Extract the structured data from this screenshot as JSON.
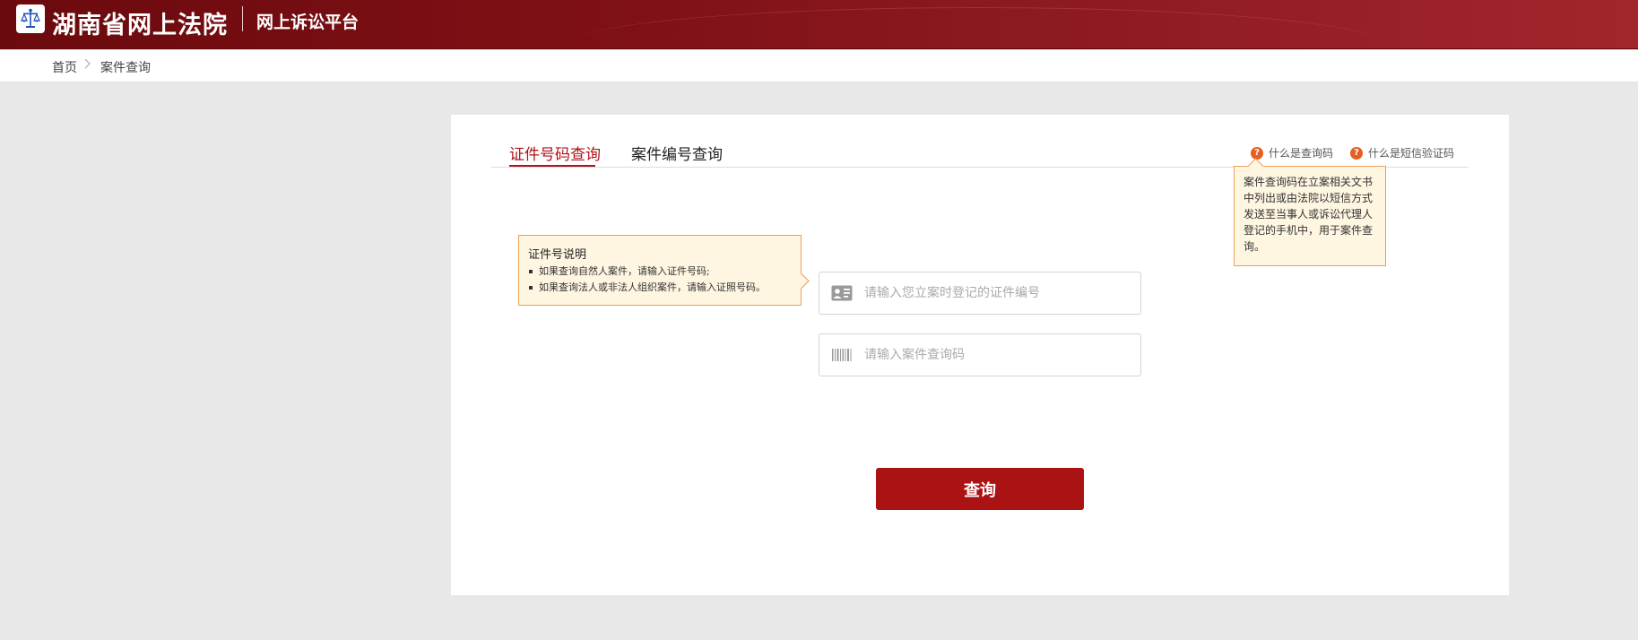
{
  "header": {
    "logo_icon": "scales-of-justice-icon",
    "site_title": "湖南省网上法院",
    "platform_name": "网上诉讼平台",
    "background_color": "#7d1015"
  },
  "breadcrumb": {
    "home": "首页",
    "separator_icon": "chevron-right-icon",
    "current": "案件查询"
  },
  "tabs": [
    {
      "label": "证件号码查询",
      "active": true
    },
    {
      "label": "案件编号查询",
      "active": false
    }
  ],
  "help_links": [
    {
      "label": "什么是查询码",
      "icon": "question-icon"
    },
    {
      "label": "什么是短信验证码",
      "icon": "question-icon"
    }
  ],
  "help_tooltip": {
    "text": "案件查询码在立案相关文书中列出或由法院以短信方式发送至当事人或诉讼代理人登记的手机中，用于案件查询。"
  },
  "id_tooltip": {
    "title": "证件号说明",
    "items": [
      "如果查询自然人案件，请输入证件号码;",
      "如果查询法人或非法人组织案件，请输入证照号码。"
    ]
  },
  "form": {
    "id_number": {
      "value": "",
      "placeholder": "请输入您立案时登记的证件编号",
      "icon": "id-card-icon"
    },
    "query_code": {
      "value": "",
      "placeholder": "请输入案件查询码",
      "icon": "barcode-icon"
    },
    "submit_label": "查询"
  },
  "colors": {
    "accent": "#b01217",
    "button": "#ab1214",
    "tooltip_bg": "#fef6e1",
    "tooltip_border": "#eaa258",
    "help_icon": "#e65f1e"
  }
}
